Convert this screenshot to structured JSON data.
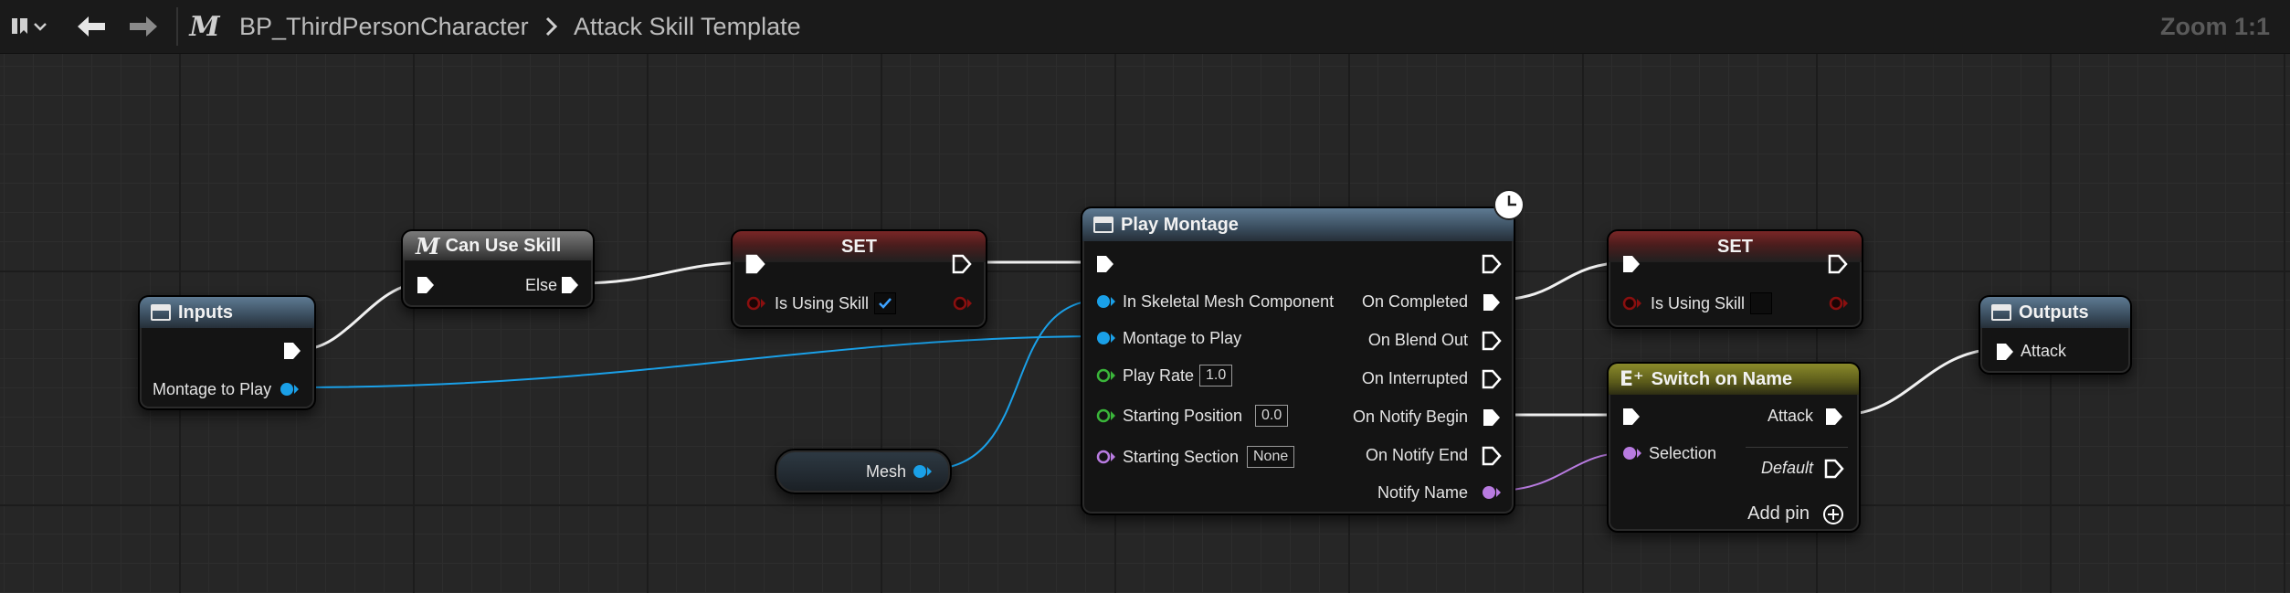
{
  "toolbar": {
    "blueprint_name": "BP_ThirdPersonCharacter",
    "graph_name": "Attack Skill Template",
    "zoom": "Zoom 1:1"
  },
  "nodes": {
    "inputs": {
      "title": "Inputs",
      "pin_montage": "Montage to Play"
    },
    "can_use_skill": {
      "title": "Can Use Skill",
      "pin_else": "Else"
    },
    "set_1": {
      "title": "SET",
      "pin_label": "Is Using Skill",
      "checked": true
    },
    "mesh": {
      "label": "Mesh"
    },
    "play_montage": {
      "title": "Play Montage",
      "in_skeletal": "In Skeletal Mesh Component",
      "montage": "Montage to Play",
      "play_rate": "Play Rate",
      "play_rate_value": "1.0",
      "start_pos": "Starting Position",
      "start_pos_value": "0.0",
      "start_section": "Starting Section",
      "start_section_value": "None",
      "on_completed": "On Completed",
      "on_blend_out": "On Blend Out",
      "on_interrupted": "On Interrupted",
      "on_notify_begin": "On Notify Begin",
      "on_notify_end": "On Notify End",
      "notify_name": "Notify Name"
    },
    "set_2": {
      "title": "SET",
      "pin_label": "Is Using Skill",
      "checked": false
    },
    "switch": {
      "title": "Switch on Name",
      "selection": "Selection",
      "attack": "Attack",
      "default": "Default",
      "add_pin": "Add pin"
    },
    "outputs": {
      "title": "Outputs",
      "attack": "Attack"
    }
  },
  "colors": {
    "exec": "#ffffff",
    "object": "#1aa0e8",
    "float": "#3ab53a",
    "name": "#b87be0",
    "bool": "#8a0f0f"
  }
}
